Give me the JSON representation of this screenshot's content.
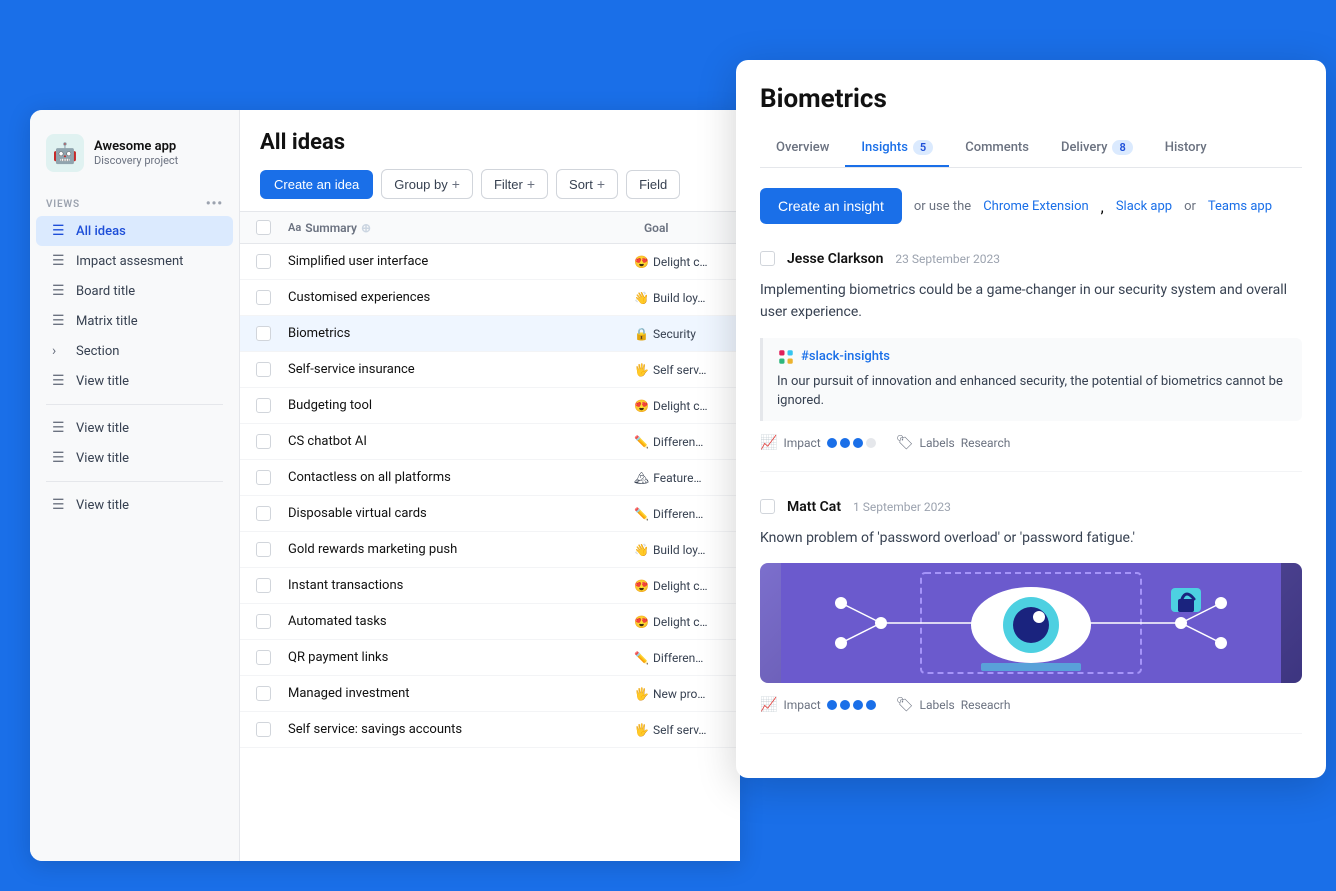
{
  "app": {
    "icon": "🤖",
    "name": "Awesome app",
    "subtitle": "Discovery project"
  },
  "sidebar": {
    "views_label": "VIEWS",
    "items": [
      {
        "id": "all-ideas",
        "label": "All ideas",
        "icon": "≡",
        "active": true
      },
      {
        "id": "impact-assessment",
        "label": "Impact assesment",
        "icon": "≡",
        "active": false
      },
      {
        "id": "board-title",
        "label": "Board title",
        "icon": "≡",
        "active": false
      },
      {
        "id": "matrix-title",
        "label": "Matrix title",
        "icon": "≡",
        "active": false
      },
      {
        "id": "section",
        "label": "Section",
        "icon": "›",
        "active": false
      },
      {
        "id": "view-title-1",
        "label": "View title",
        "icon": "≡",
        "active": false
      }
    ],
    "items2": [
      {
        "id": "view-title-2",
        "label": "View title",
        "icon": "≡",
        "active": false
      },
      {
        "id": "view-title-3",
        "label": "View title",
        "icon": "≡",
        "active": false
      }
    ],
    "items3": [
      {
        "id": "view-title-4",
        "label": "View title",
        "icon": "≡",
        "active": false
      }
    ]
  },
  "ideas": {
    "title": "All ideas",
    "toolbar": {
      "create_label": "Create an idea",
      "group_by_label": "Group by",
      "filter_label": "Filter",
      "sort_label": "Sort",
      "fields_label": "Field"
    },
    "columns": {
      "summary": "Summary",
      "goal": "Goal"
    },
    "rows": [
      {
        "id": 1,
        "summary": "Simplified user interface",
        "goal_emoji": "😍",
        "goal_text": "Delight c",
        "highlighted": false
      },
      {
        "id": 2,
        "summary": "Customised experiences",
        "goal_emoji": "👋",
        "goal_text": "Build loy",
        "highlighted": false
      },
      {
        "id": 3,
        "summary": "Biometrics",
        "goal_emoji": "🔒",
        "goal_text": "Security",
        "highlighted": true
      },
      {
        "id": 4,
        "summary": "Self-service insurance",
        "goal_emoji": "🖐",
        "goal_text": "Self serv",
        "highlighted": false
      },
      {
        "id": 5,
        "summary": "Budgeting tool",
        "goal_emoji": "😍",
        "goal_text": "Delight c",
        "highlighted": false
      },
      {
        "id": 6,
        "summary": "CS chatbot AI",
        "goal_emoji": "🖊",
        "goal_text": "Differen",
        "highlighted": false
      },
      {
        "id": 7,
        "summary": "Contactless on all platforms",
        "goal_emoji": "🏔",
        "goal_text": "Feature",
        "highlighted": false
      },
      {
        "id": 8,
        "summary": "Disposable virtual cards",
        "goal_emoji": "🖊",
        "goal_text": "Differen",
        "highlighted": false
      },
      {
        "id": 9,
        "summary": "Gold rewards marketing push",
        "goal_emoji": "👋",
        "goal_text": "Build loy",
        "highlighted": false
      },
      {
        "id": 10,
        "summary": "Instant transactions",
        "goal_emoji": "😍",
        "goal_text": "Delight c",
        "highlighted": false
      },
      {
        "id": 11,
        "summary": "Automated tasks",
        "goal_emoji": "😍",
        "goal_text": "Delight c",
        "highlighted": false
      },
      {
        "id": 12,
        "summary": "QR payment links",
        "goal_emoji": "🖊",
        "goal_text": "Differen",
        "highlighted": false
      },
      {
        "id": 13,
        "summary": "Managed investment",
        "goal_emoji": "🖐",
        "goal_text": "New pro",
        "highlighted": false
      },
      {
        "id": 14,
        "summary": "Self service: savings accounts",
        "goal_emoji": "🖐",
        "goal_text": "Self serv",
        "highlighted": false
      }
    ]
  },
  "detail": {
    "title": "Biometrics",
    "tabs": [
      {
        "id": "overview",
        "label": "Overview",
        "badge": null,
        "active": false
      },
      {
        "id": "insights",
        "label": "Insights",
        "badge": "5",
        "active": true
      },
      {
        "id": "comments",
        "label": "Comments",
        "badge": null,
        "active": false
      },
      {
        "id": "delivery",
        "label": "Delivery",
        "badge": "8",
        "active": false
      },
      {
        "id": "history",
        "label": "History",
        "badge": null,
        "active": false
      }
    ],
    "create_insight_label": "Create an insight",
    "or_text": "or use the",
    "chrome_extension": "Chrome Extension",
    "slack_app": "Slack app",
    "teams_app": "Teams app",
    "insights": [
      {
        "id": 1,
        "author": "Jesse Clarkson",
        "date": "23 September 2023",
        "text": "Implementing biometrics could be a game-changer in our security system and overall user experience.",
        "slack_channel": "#slack-insights",
        "slack_text": "In our pursuit of innovation and enhanced security, the potential of biometrics cannot be ignored.",
        "impact_dots": 3,
        "total_dots": 4,
        "labels_label": "Labels",
        "labels_value": "Research",
        "has_image": false
      },
      {
        "id": 2,
        "author": "Matt Cat",
        "date": "1 September 2023",
        "text": "Known problem of 'password overload' or 'password fatigue.'",
        "slack_channel": null,
        "slack_text": null,
        "impact_dots": 4,
        "total_dots": 4,
        "labels_label": "Labels",
        "labels_value": "Reseacrh",
        "has_image": true
      }
    ]
  }
}
